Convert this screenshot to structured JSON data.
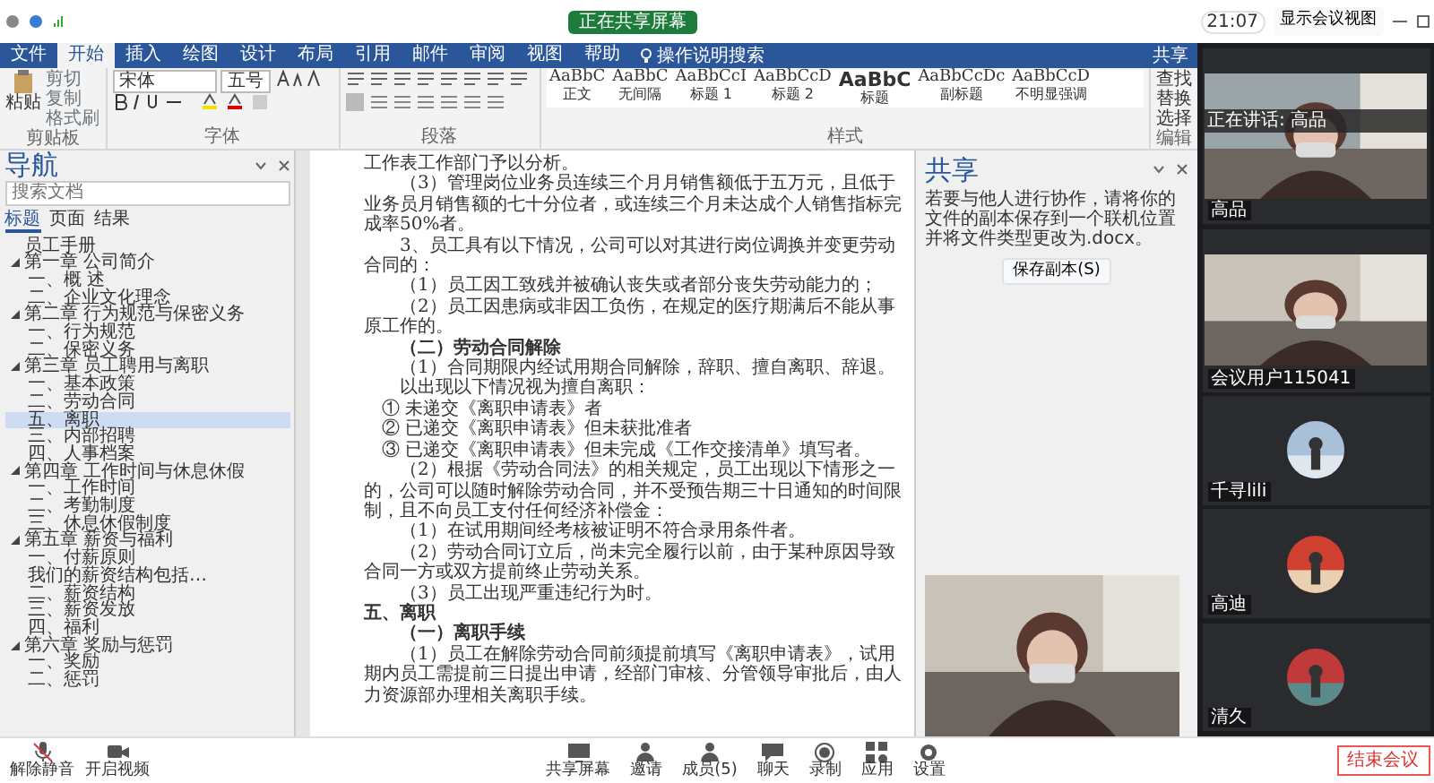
{
  "top_bar": {
    "sharing_tag": "正在共享屏幕",
    "time": "21:07",
    "view_button": "显示会议视图"
  },
  "ribbon": {
    "tabs": [
      {
        "label": "文件",
        "selected": false
      },
      {
        "label": "开始",
        "selected": true
      },
      {
        "label": "插入",
        "selected": false
      },
      {
        "label": "绘图",
        "selected": false
      },
      {
        "label": "设计",
        "selected": false
      },
      {
        "label": "布局",
        "selected": false
      },
      {
        "label": "引用",
        "selected": false
      },
      {
        "label": "邮件",
        "selected": false
      },
      {
        "label": "审阅",
        "selected": false
      },
      {
        "label": "视图",
        "selected": false
      },
      {
        "label": "帮助",
        "selected": false
      }
    ],
    "search": "操作说明搜索",
    "share": "共享",
    "clipboard": {
      "paste": "粘贴",
      "cut": "剪切",
      "copy": "复制",
      "format_painter": "格式刷"
    },
    "font": {
      "name": "宋体",
      "size": "五号"
    },
    "group_labels": [
      "剪贴板",
      "字体",
      "段落",
      "样式"
    ],
    "styles": [
      {
        "sample": "AaBbC",
        "name": "正文"
      },
      {
        "sample": "AaBbC",
        "name": "无间隔"
      },
      {
        "sample": "AaBbCcI",
        "name": "标题 1"
      },
      {
        "sample": "AaBbCcD",
        "name": "标题 2"
      },
      {
        "sample": "AaBbC",
        "name": "标题"
      },
      {
        "sample": "AaBbCcDc",
        "name": "副标题"
      },
      {
        "sample": "AaBbCcD",
        "name": "不明显强调"
      }
    ],
    "editing": [
      "查找",
      "替换",
      "选择"
    ],
    "editing_label": "编辑"
  },
  "navigation": {
    "title": "导航",
    "placeholder": "搜索文档",
    "tabs": [
      {
        "label": "标题",
        "selected": true
      },
      {
        "label": "页面",
        "selected": false
      },
      {
        "label": "结果",
        "selected": false
      }
    ],
    "items": [
      {
        "label": "员工手册",
        "selected": false
      },
      {
        "label": "第一章 公司简介",
        "selected": false,
        "expanded": true,
        "children": [
          {
            "label": "一、概 述",
            "selected": false
          },
          {
            "label": "二、企业文化理念",
            "selected": false
          }
        ]
      },
      {
        "label": "第二章 行为规范与保密义务",
        "selected": false,
        "expanded": true,
        "children": [
          {
            "label": "一、行为规范",
            "selected": false
          },
          {
            "label": "二、保密义务",
            "selected": false
          }
        ]
      },
      {
        "label": "第三章 员工聘用与离职",
        "selected": false,
        "expanded": true,
        "children": [
          {
            "label": "一、基本政策",
            "selected": false
          },
          {
            "label": "二、劳动合同",
            "selected": false
          },
          {
            "label": "五、离职",
            "selected": true
          },
          {
            "label": "三、内部招聘",
            "selected": false
          },
          {
            "label": "四、人事档案",
            "selected": false
          }
        ]
      },
      {
        "label": "第四章 工作时间与休息休假",
        "selected": false,
        "expanded": true,
        "children": [
          {
            "label": "一、工作时间",
            "selected": false
          },
          {
            "label": "二、考勤制度",
            "selected": false
          },
          {
            "label": "三、休息休假制度",
            "selected": false
          }
        ]
      },
      {
        "label": "第五章 薪资与福利",
        "selected": false,
        "expanded": true,
        "children": [
          {
            "label": "一、付薪原则",
            "selected": false
          },
          {
            "label": "我们的薪资结构包括…",
            "selected": false
          },
          {
            "label": "二、薪资结构",
            "selected": false
          },
          {
            "label": "三、薪资发放",
            "selected": false
          },
          {
            "label": "四、福利",
            "selected": false
          }
        ]
      },
      {
        "label": "第六章 奖励与惩罚",
        "selected": false,
        "expanded": true,
        "children": [
          {
            "label": "一、奖励",
            "selected": false
          },
          {
            "label": "二、惩罚",
            "selected": false
          }
        ]
      }
    ]
  },
  "document": {
    "paragraphs": [
      {
        "kind": "plain",
        "text": "工作表工作部门予以分析。"
      },
      {
        "kind": "para",
        "text": "（3）管理岗位业务员连续三个月月销售额低于五万元，且低于业务员月销售额的七十分位者，或连续三个月未达成个人销售指标完成率50%者。"
      },
      {
        "kind": "para",
        "text": "3、员工具有以下情况，公司可以对其进行岗位调换并变更劳动合同的："
      },
      {
        "kind": "para",
        "text": "（1）员工因工致残并被确认丧失或者部分丧失劳动能力的；"
      },
      {
        "kind": "para",
        "text": "（2）员工因患病或非因工负伤，在规定的医疗期满后不能从事原工作的。"
      },
      {
        "kind": "subhead",
        "text": "（二）劳动合同解除"
      },
      {
        "kind": "para",
        "text": "（1）合同期限内经试用期合同解除，辞职、擅自离职、辞退。"
      },
      {
        "kind": "para",
        "text": "以出现以下情况视为擅自离职："
      },
      {
        "kind": "item",
        "text": "① 未递交《离职申请表》者"
      },
      {
        "kind": "item",
        "text": "② 已递交《离职申请表》但未获批准者"
      },
      {
        "kind": "item",
        "text": "③ 已递交《离职申请表》但未完成《工作交接清单》填写者。"
      },
      {
        "kind": "para",
        "text": "（2）根据《劳动合同法》的相关规定，员工出现以下情形之一的，公司可以随时解除劳动合同，并不受预告期三十日通知的时间限制，且不向员工支付任何经济补偿金："
      },
      {
        "kind": "para",
        "text": "（1）在试用期间经考核被证明不符合录用条件者。"
      },
      {
        "kind": "para",
        "text": "（2）劳动合同订立后，尚未完全履行以前，由于某种原因导致合同一方或双方提前终止劳动关系。"
      },
      {
        "kind": "para",
        "text": "（3）员工出现严重违纪行为时。"
      },
      {
        "kind": "heading",
        "text": "五、离职"
      },
      {
        "kind": "subhead",
        "text": "（一）离职手续"
      },
      {
        "kind": "para",
        "text": "（1）员工在解除劳动合同前须提前填写《离职申请表》，试用期内员工需提前三日提出申请，经部门审核、分管领导审批后，由人力资源部办理相关离职手续。"
      }
    ]
  },
  "share_pane": {
    "title": "共享",
    "message": "若要与他人进行协作，请将你的文件的副本保存到一个联机位置并将文件类型更改为.docx。",
    "button": "保存副本(S)"
  },
  "video": {
    "speaking": "正在讲话: 高品",
    "tiles": [
      {
        "name": "高品",
        "kind": "camera"
      },
      {
        "name": "会议用户115041",
        "kind": "camera"
      },
      {
        "name": "千寻lili",
        "kind": "avatar"
      },
      {
        "name": "高迪",
        "kind": "avatar"
      },
      {
        "name": "清久",
        "kind": "avatar"
      }
    ]
  },
  "toolbar": {
    "left": [
      {
        "label": "解除静音",
        "kind": "mic"
      },
      {
        "label": "开启视频",
        "kind": "camera"
      }
    ],
    "center": [
      {
        "label": "共享屏幕",
        "kind": "screen"
      },
      {
        "label": "邀请",
        "kind": "invite"
      },
      {
        "label": "成员(5)",
        "kind": "members"
      },
      {
        "label": "聊天",
        "kind": "chat"
      },
      {
        "label": "录制",
        "kind": "record"
      },
      {
        "label": "应用",
        "kind": "apps"
      },
      {
        "label": "设置",
        "kind": "settings"
      }
    ],
    "end_button": "结束会议"
  }
}
